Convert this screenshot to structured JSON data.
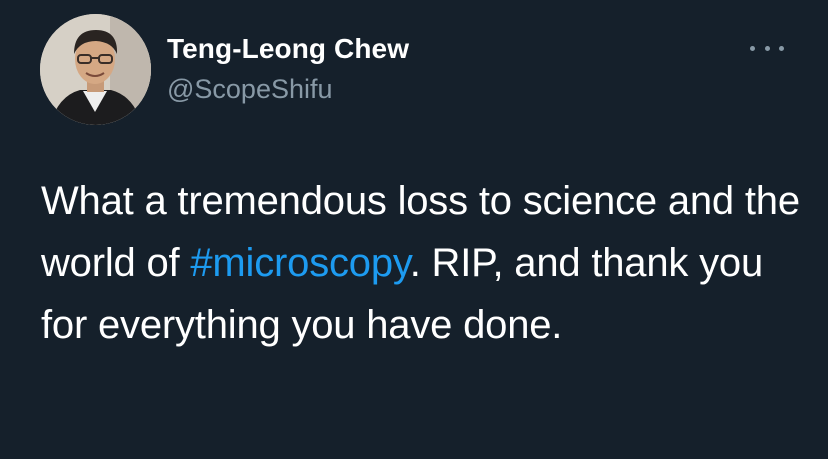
{
  "author": {
    "display_name": "Teng-Leong Chew",
    "handle": "@ScopeShifu",
    "avatar_icon": "profile-photo"
  },
  "tweet": {
    "text_part1": "What a tremendous loss to science and the world of ",
    "hashtag": "#microscopy",
    "text_part2": ". RIP, and thank you for everything you have done."
  },
  "menu_icon": "more-dots-icon",
  "colors": {
    "background": "#15202b",
    "text": "#ffffff",
    "secondary": "#8899a6",
    "accent": "#1d9bf0"
  }
}
